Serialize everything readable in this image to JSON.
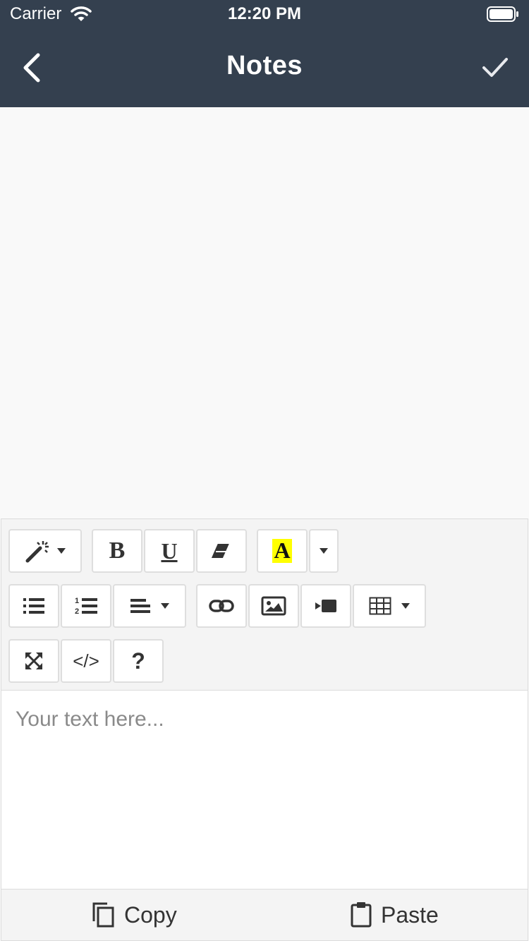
{
  "status_bar": {
    "carrier": "Carrier",
    "time": "12:20 PM"
  },
  "nav": {
    "title": "Notes",
    "back_icon": "chevron-left-icon",
    "done_icon": "checkmark-icon"
  },
  "toolbar": {
    "row1": [
      {
        "name": "style-magic-button",
        "icon": "magic-wand-icon",
        "has_caret": true
      },
      {
        "name": "bold-button",
        "label": "B"
      },
      {
        "name": "underline-button",
        "label": "U"
      },
      {
        "name": "clear-format-button",
        "icon": "eraser-icon"
      },
      {
        "name": "highlight-color-button",
        "label": "A",
        "highlight_color": "#ffff00"
      },
      {
        "name": "color-dropdown-button",
        "icon": "caret-down-icon"
      }
    ],
    "row2": [
      {
        "name": "unordered-list-button",
        "icon": "bulleted-list-icon"
      },
      {
        "name": "ordered-list-button",
        "icon": "numbered-list-icon",
        "numbers": [
          "1",
          "2"
        ]
      },
      {
        "name": "align-dropdown-button",
        "icon": "align-left-icon"
      },
      {
        "name": "link-button",
        "icon": "link-icon"
      },
      {
        "name": "image-button",
        "icon": "image-icon"
      },
      {
        "name": "video-button",
        "icon": "video-icon"
      },
      {
        "name": "table-button",
        "icon": "table-icon"
      }
    ],
    "row3": [
      {
        "name": "fullscreen-button",
        "icon": "fullscreen-icon"
      },
      {
        "name": "code-view-button",
        "label": "</>"
      },
      {
        "name": "help-button",
        "label": "?"
      }
    ]
  },
  "editor": {
    "placeholder": "Your text here..."
  },
  "bottom_bar": {
    "copy_label": "Copy",
    "paste_label": "Paste"
  },
  "colors": {
    "header_bg": "#34404f",
    "toolbar_bg": "#f4f4f4",
    "highlight": "#ffff00"
  }
}
